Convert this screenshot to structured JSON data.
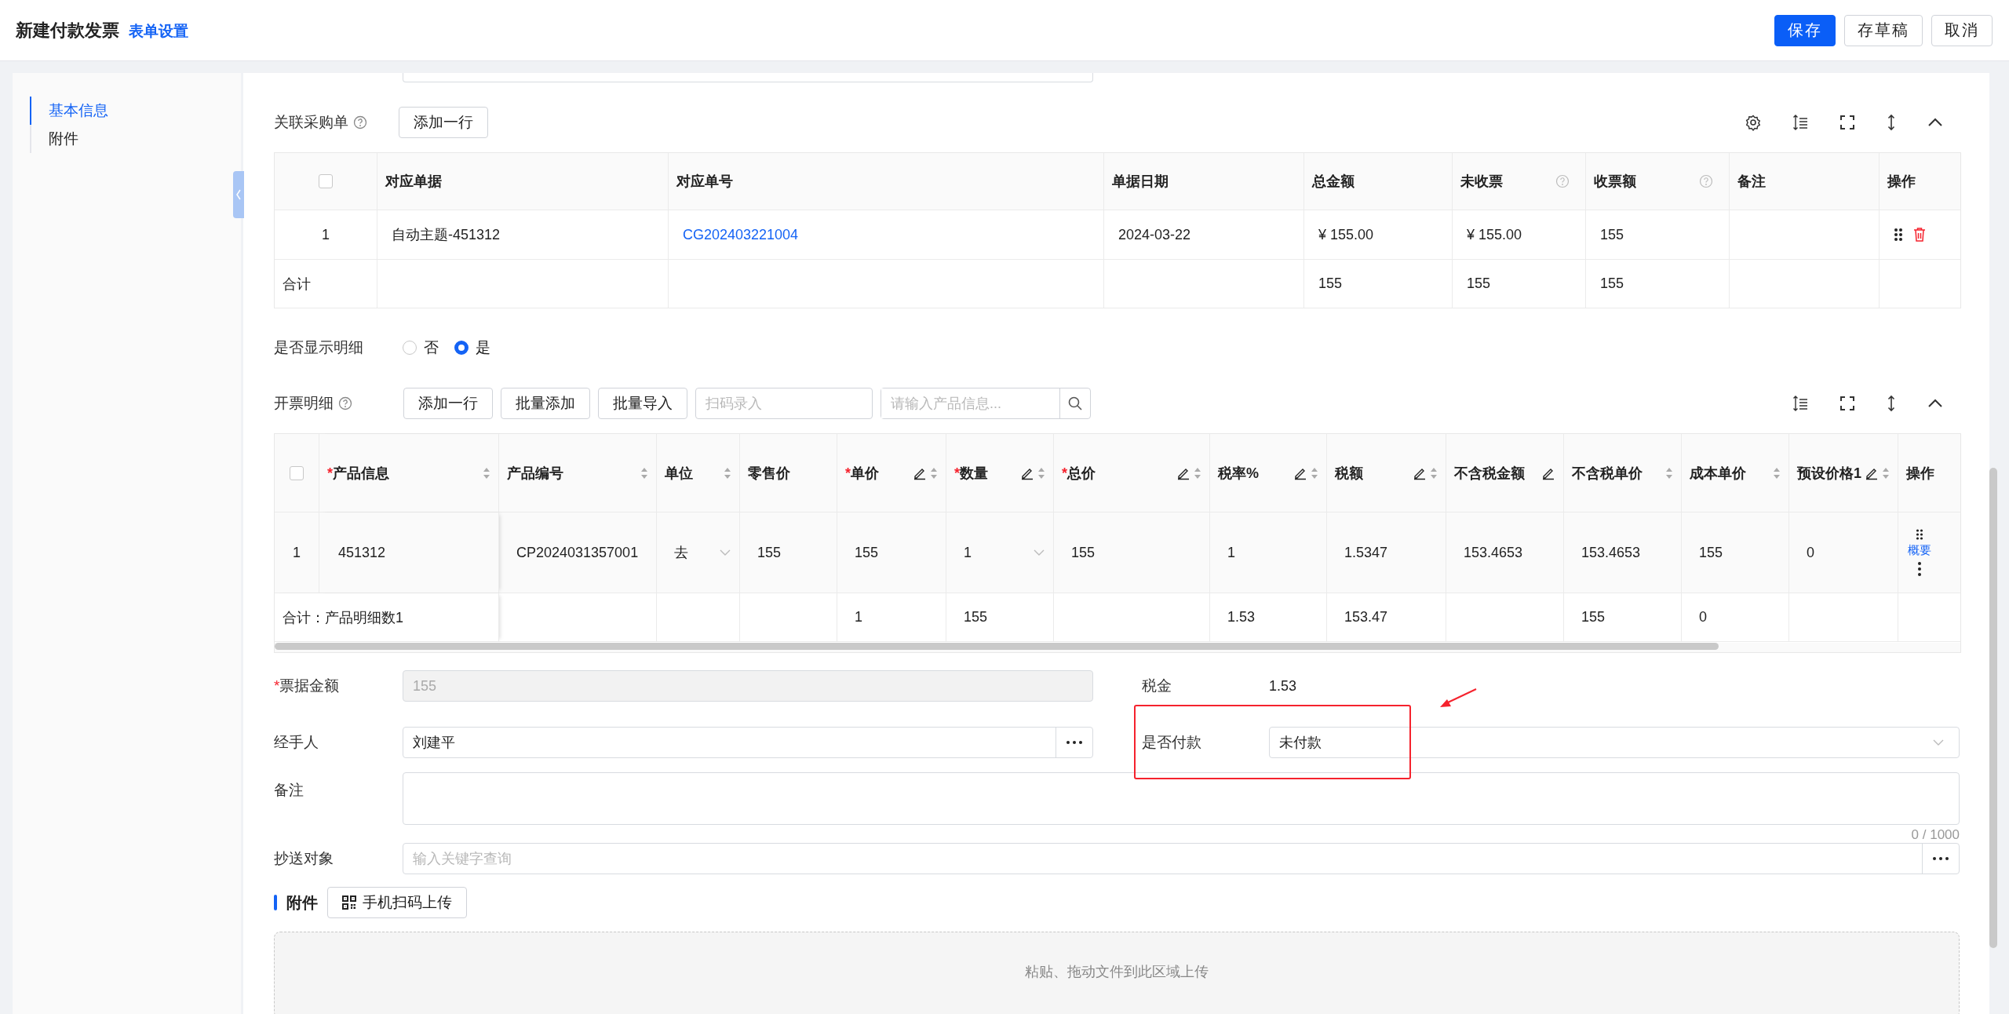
{
  "required_mark": "*",
  "header": {
    "title": "新建付款发票",
    "settings_link": "表单设置",
    "buttons": [
      {
        "label": "保存",
        "primary": true
      },
      {
        "label": "存草稿",
        "primary": false
      },
      {
        "label": "取消",
        "primary": false
      }
    ]
  },
  "sidebar": {
    "items": [
      {
        "label": "基本信息",
        "selected": true
      },
      {
        "label": "附件",
        "selected": false
      }
    ]
  },
  "purchase_orders": {
    "label": "关联采购单",
    "add_button": "添加一行",
    "header_checked": false,
    "columns": [
      {
        "label": "对应单据",
        "kind": "text",
        "help": false
      },
      {
        "label": "对应单号",
        "kind": "link",
        "help": false
      },
      {
        "label": "单据日期",
        "kind": "text",
        "help": false
      },
      {
        "label": "总金额",
        "kind": "text",
        "help": false
      },
      {
        "label": "未收票",
        "kind": "text",
        "help": true
      },
      {
        "label": "收票额",
        "kind": "text",
        "help": true
      },
      {
        "label": "备注",
        "kind": "text",
        "help": false
      },
      {
        "label": "操作",
        "kind": "actions",
        "help": false
      }
    ],
    "rows": [
      {
        "kind": "item",
        "index": "1",
        "cells": [
          "自动主题-451312",
          "CG202403221004",
          "2024-03-22",
          "¥ 155.00",
          "¥ 155.00",
          "155",
          null,
          null
        ]
      },
      {
        "kind": "total",
        "index": "合计",
        "cells": [
          null,
          null,
          null,
          "155",
          "155",
          "155",
          null,
          null
        ]
      }
    ]
  },
  "show_detail": {
    "label": "是否显示明细",
    "options": [
      {
        "label": "否",
        "selected": false
      },
      {
        "label": "是",
        "selected": true
      }
    ]
  },
  "details": {
    "label": "开票明细",
    "buttons": [
      "添加一行",
      "批量添加",
      "批量导入"
    ],
    "scan_placeholder": "扫码录入",
    "search_placeholder": "请输入产品信息...",
    "header_checked": false,
    "columns": [
      {
        "label": "产品信息",
        "required": true,
        "editable": false,
        "sortable": true,
        "kind": "text"
      },
      {
        "label": "产品编号",
        "required": false,
        "editable": false,
        "sortable": true,
        "kind": "text"
      },
      {
        "label": "单位",
        "required": false,
        "editable": false,
        "sortable": true,
        "kind": "select"
      },
      {
        "label": "零售价",
        "required": false,
        "editable": false,
        "sortable": false,
        "kind": "text"
      },
      {
        "label": "单价",
        "required": true,
        "editable": true,
        "sortable": true,
        "kind": "text"
      },
      {
        "label": "数量",
        "required": true,
        "editable": true,
        "sortable": true,
        "kind": "select"
      },
      {
        "label": "总价",
        "required": true,
        "editable": true,
        "sortable": true,
        "kind": "text"
      },
      {
        "label": "税率%",
        "required": false,
        "editable": true,
        "sortable": true,
        "kind": "text"
      },
      {
        "label": "税额",
        "required": false,
        "editable": true,
        "sortable": true,
        "kind": "text"
      },
      {
        "label": "不含税金额",
        "required": false,
        "editable": true,
        "sortable": false,
        "kind": "text"
      },
      {
        "label": "不含税单价",
        "required": false,
        "editable": false,
        "sortable": true,
        "kind": "text"
      },
      {
        "label": "成本单价",
        "required": false,
        "editable": false,
        "sortable": true,
        "kind": "text"
      },
      {
        "label": "预设价格1",
        "required": false,
        "editable": true,
        "sortable": true,
        "kind": "text"
      },
      {
        "label": "操作",
        "required": false,
        "editable": false,
        "sortable": false,
        "kind": "actions"
      }
    ],
    "rows": [
      {
        "kind": "item",
        "index": "1",
        "action_link": "概要",
        "cells": [
          "451312",
          "CP2024031357001",
          "去",
          "155",
          "155",
          "1",
          "155",
          "1",
          "1.5347",
          "153.4653",
          "153.4653",
          "155",
          "0",
          null
        ]
      },
      {
        "kind": "total",
        "index": "合计：产品明细数1",
        "cells": [
          null,
          null,
          null,
          null,
          "1",
          "155",
          null,
          "1.53",
          "153.47",
          null,
          "155",
          "0",
          null
        ]
      }
    ]
  },
  "form": {
    "amount": {
      "label": "票据金额",
      "required": true,
      "value": "155",
      "disabled": true
    },
    "tax": {
      "label": "税金",
      "value": "1.53"
    },
    "handler": {
      "label": "经手人",
      "value": "刘建平"
    },
    "paid": {
      "label": "是否付款",
      "value": "未付款"
    },
    "remark": {
      "label": "备注",
      "counter": "0 / 1000"
    },
    "cc": {
      "label": "抄送对象",
      "placeholder": "输入关键字查询"
    }
  },
  "attachments": {
    "title": "附件",
    "upload_button": "手机扫码上传",
    "dropzone": "粘贴、拖动文件到此区域上传"
  }
}
